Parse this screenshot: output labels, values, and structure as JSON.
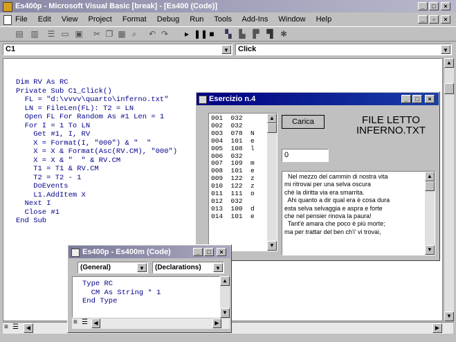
{
  "main_window": {
    "title": "Es400p - Microsoft Visual Basic [break] - [Es400 (Code)]",
    "menu": [
      "File",
      "Edit",
      "View",
      "Project",
      "Format",
      "Debug",
      "Run",
      "Tools",
      "Add-Ins",
      "Window",
      "Help"
    ],
    "object_combo": "C1",
    "procedure_combo": "Click"
  },
  "code_lines": [
    "Dim RV As RC",
    "Private Sub C1_Click()",
    "  FL = \"d:\\vvvv\\quarto\\inferno.txt\"",
    "  LN = FileLen(FL): T2 = LN",
    "  Open FL For Random As #1 Len = 1",
    "  For I = 1 To LN",
    "    Get #1, I, RV",
    "    X = Format(I, \"000\") & \"  \"",
    "    X = X & Format(Asc(RV.CM), \"000\")",
    "    X = X & \"  \" & RV.CM",
    "    T1 = T1 & RV.CM",
    "    T2 = T2 - 1",
    "    DoEvents",
    "    L1.AddItem X",
    "  Next I",
    "  Close #1",
    "End Sub"
  ],
  "form": {
    "title": "Esercizio n.4",
    "button_label": "Carica",
    "heading_line1": "FILE LETTO",
    "heading_line2": "INFERNO.TXT",
    "counter_value": "0",
    "list_items": [
      "001  032",
      "002  032",
      "003  078  N",
      "004  101  e",
      "005  108  l",
      "006  032",
      "007  109  m",
      "008  101  e",
      "009  122  z",
      "010  122  z",
      "011  111  o",
      "012  032",
      "013  100  d",
      "014  101  e"
    ],
    "text_lines": [
      "  Nel mezzo del cammin di nostra vita",
      "mi ritrovai per una selva oscura",
      "chè la diritta via era smarrita.",
      "  Ahi quanto a dir qual era è cosa dura",
      "esta selva selvaggia e aspra e forte",
      "che nel pensier rinova la paura!",
      "  Tant'è amara che poco è più morte;",
      "ma per trattar del ben ch'i' vi trovai,"
    ]
  },
  "code_window2": {
    "title": "Es400p - Es400m (Code)",
    "object_combo": "(General)",
    "procedure_combo": "(Declarations)",
    "code_lines": [
      "Type RC",
      "  CM As String * 1",
      "End Type"
    ]
  },
  "colors": {
    "code_text": "#00008b",
    "title_active": "#000080",
    "title_inactive": "#8a8aa8",
    "desktop": "#c0c0c0"
  }
}
